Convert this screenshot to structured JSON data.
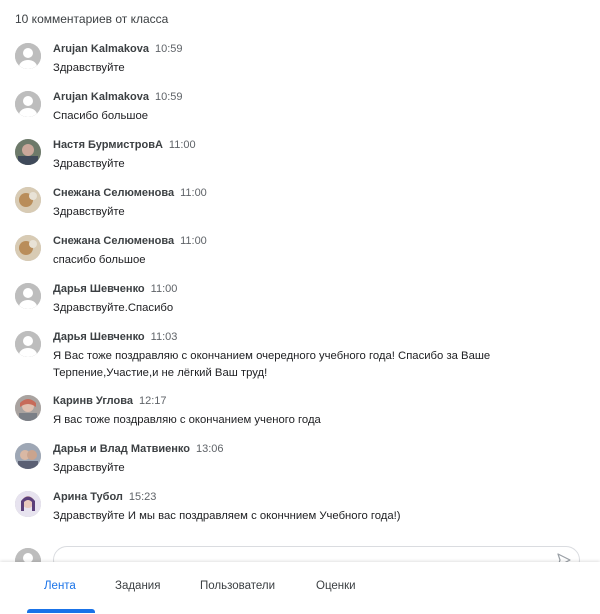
{
  "header": {
    "title": "10 комментариев от класса"
  },
  "comments": [
    {
      "author": "Arujan Kalmakova",
      "time": "10:59",
      "text": "Здравствуйте"
    },
    {
      "author": "Arujan Kalmakova",
      "time": "10:59",
      "text": "Спасибо большое"
    },
    {
      "author": "Настя БурмистровА",
      "time": "11:00",
      "text": "Здравствуйте"
    },
    {
      "author": "Снежана Селюменова",
      "time": "11:00",
      "text": "Здравствуйте"
    },
    {
      "author": "Снежана Селюменова",
      "time": "11:00",
      "text": "спасибо большое"
    },
    {
      "author": "Дарья Шевченко",
      "time": "11:00",
      "text": "Здравствуйте.Спасибо"
    },
    {
      "author": "Дарья Шевченко",
      "time": "11:03",
      "text": "Я Вас тоже поздравляю с окончанием очередного учебного года! Спасибо за Ваше Терпение,Участие,и не лёгкий Ваш труд!"
    },
    {
      "author": "Каринв Углова",
      "time": "12:17",
      "text": "Я вас тоже поздравляю с окончанием ученого года"
    },
    {
      "author": "Дарья и Влад Матвиенко",
      "time": "13:06",
      "text": "Здравствуйте"
    },
    {
      "author": "Арина Тубол",
      "time": "15:23",
      "text": "Здравствуйте И мы вас поздравляем с окончнием Учебного года!)"
    }
  ],
  "tabs": [
    {
      "label": "Лента",
      "active": true
    },
    {
      "label": "Задания",
      "active": false
    },
    {
      "label": "Пользователи",
      "active": false
    },
    {
      "label": "Оценки",
      "active": false
    }
  ],
  "colors": {
    "accent": "#1a73e8",
    "avatar_default": "#bdbdbd"
  }
}
